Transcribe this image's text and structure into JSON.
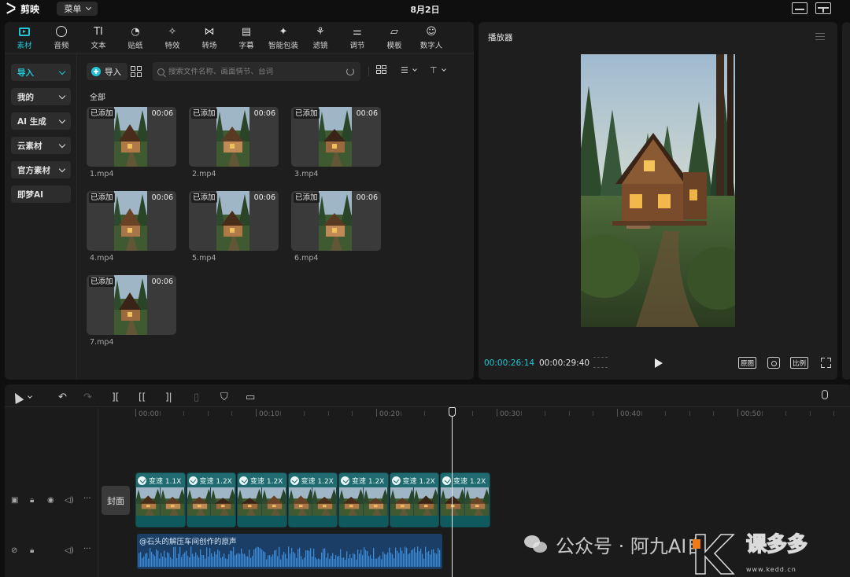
{
  "app": {
    "logo_text": "剪映",
    "menu_label": "菜单",
    "date": "8月2日"
  },
  "tabs": [
    {
      "id": "media",
      "label": "素材",
      "icon": "media-icon",
      "active": true
    },
    {
      "id": "audio",
      "label": "音频",
      "icon": "music-icon"
    },
    {
      "id": "text",
      "label": "文本",
      "icon": "text-icon"
    },
    {
      "id": "sticker",
      "label": "贴纸",
      "icon": "sticker-icon"
    },
    {
      "id": "effects",
      "label": "特效",
      "icon": "sparkle-icon"
    },
    {
      "id": "transition",
      "label": "转场",
      "icon": "transition-icon"
    },
    {
      "id": "subtitle",
      "label": "字幕",
      "icon": "subtitle-icon"
    },
    {
      "id": "smart",
      "label": "智能包装",
      "icon": "magic-icon"
    },
    {
      "id": "filter",
      "label": "滤镜",
      "icon": "filter-icon"
    },
    {
      "id": "adjust",
      "label": "调节",
      "icon": "sliders-icon"
    },
    {
      "id": "template",
      "label": "模板",
      "icon": "template-icon"
    },
    {
      "id": "avatar",
      "label": "数字人",
      "icon": "digital-human-icon"
    }
  ],
  "sidebar": [
    {
      "label": "导入",
      "active": true,
      "chevron": true
    },
    {
      "label": "我的",
      "chevron": true
    },
    {
      "label": "AI 生成",
      "chevron": true
    },
    {
      "label": "云素材",
      "chevron": true
    },
    {
      "label": "官方素材",
      "chevron": true
    },
    {
      "label": "即梦AI",
      "chevron": false
    }
  ],
  "media_toolbar": {
    "import_label": "导入",
    "search_placeholder": "搜索文件名称、画面情节、台词"
  },
  "media": {
    "section_label": "全部",
    "items": [
      {
        "name": "1.mp4",
        "tag": "已添加",
        "duration": "00:06"
      },
      {
        "name": "2.mp4",
        "tag": "已添加",
        "duration": "00:06"
      },
      {
        "name": "3.mp4",
        "tag": "已添加",
        "duration": "00:06"
      },
      {
        "name": "4.mp4",
        "tag": "已添加",
        "duration": "00:06"
      },
      {
        "name": "5.mp4",
        "tag": "已添加",
        "duration": "00:06"
      },
      {
        "name": "6.mp4",
        "tag": "已添加",
        "duration": "00:06"
      },
      {
        "name": "7.mp4",
        "tag": "已添加",
        "duration": "00:06"
      }
    ]
  },
  "player": {
    "title": "播放器",
    "current_time": "00:00:26:14",
    "total_time": "00:00:29:40",
    "original_label": "原图",
    "ratio_label": "比例"
  },
  "timeline": {
    "ruler": [
      "00:00",
      "00:10",
      "00:20",
      "00:30",
      "00:40",
      "00:50"
    ],
    "cover_label": "封面",
    "clips": [
      {
        "speed_label": "变速 1.1X"
      },
      {
        "speed_label": "变速 1.2X"
      },
      {
        "speed_label": "变速 1.2X"
      },
      {
        "speed_label": "变速 1.2X"
      },
      {
        "speed_label": "变速 1.2X"
      },
      {
        "speed_label": "变速 1.2X"
      },
      {
        "speed_label": "变速 1.2X"
      }
    ],
    "audio_label": "@石头的解压车间创作的原声"
  },
  "watermark": {
    "text": "公众号 · 阿九AI自",
    "brand": "课多多",
    "url": "www.kedd.cn"
  },
  "colors": {
    "accent": "#21c6d6",
    "clip": "#1f6b6f",
    "audio": "#1a3e66"
  }
}
